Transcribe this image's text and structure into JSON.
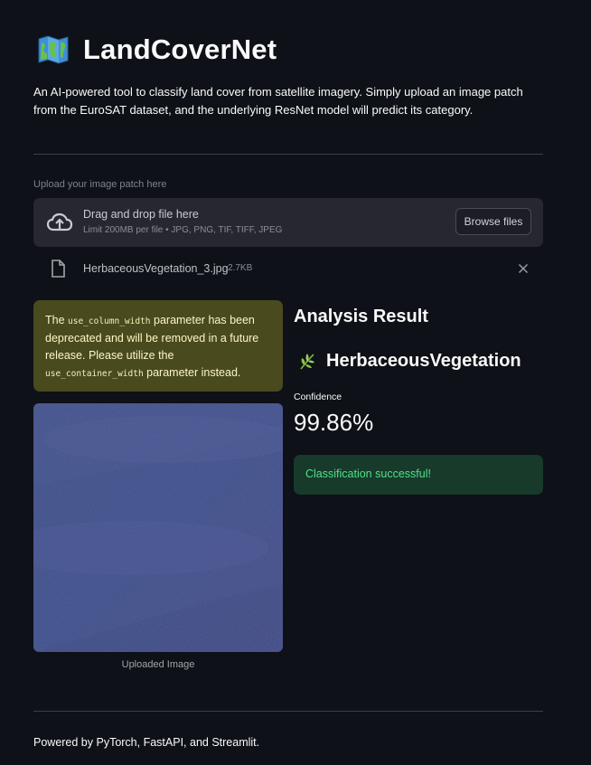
{
  "header": {
    "icon": "map-icon",
    "title": "LandCoverNet",
    "intro": "An AI-powered tool to classify land cover from satellite imagery. Simply upload an image patch from the EuroSAT dataset, and the underlying ResNet model will predict its category."
  },
  "uploader": {
    "label": "Upload your image patch here",
    "drop_title": "Drag and drop file here",
    "limit": "Limit 200MB per file • JPG, PNG, TIF, TIFF, JPEG",
    "browse_label": "Browse files",
    "file_name": "HerbaceousVegetation_3.jpg",
    "file_size": "2.7KB"
  },
  "warning": {
    "text_1": "The ",
    "code_1": "use_column_width",
    "text_2": " parameter has been deprecated and will be removed in a future release. Please utilize the ",
    "code_2": "use_container_width",
    "text_3": " parameter instead."
  },
  "image": {
    "caption": "Uploaded Image"
  },
  "result": {
    "title": "Analysis Result",
    "class_icon": "leaf-icon",
    "class_name": "HerbaceousVegetation",
    "confidence_label": "Confidence",
    "confidence_value": "99.86%",
    "success_message": "Classification successful!"
  },
  "footer": {
    "text": "Powered by PyTorch, FastAPI, and Streamlit."
  },
  "colors": {
    "background": "#0e1117",
    "warning_bg": "#4a4a1f",
    "success_bg": "#173a2a",
    "success_text": "#4fe08a"
  }
}
